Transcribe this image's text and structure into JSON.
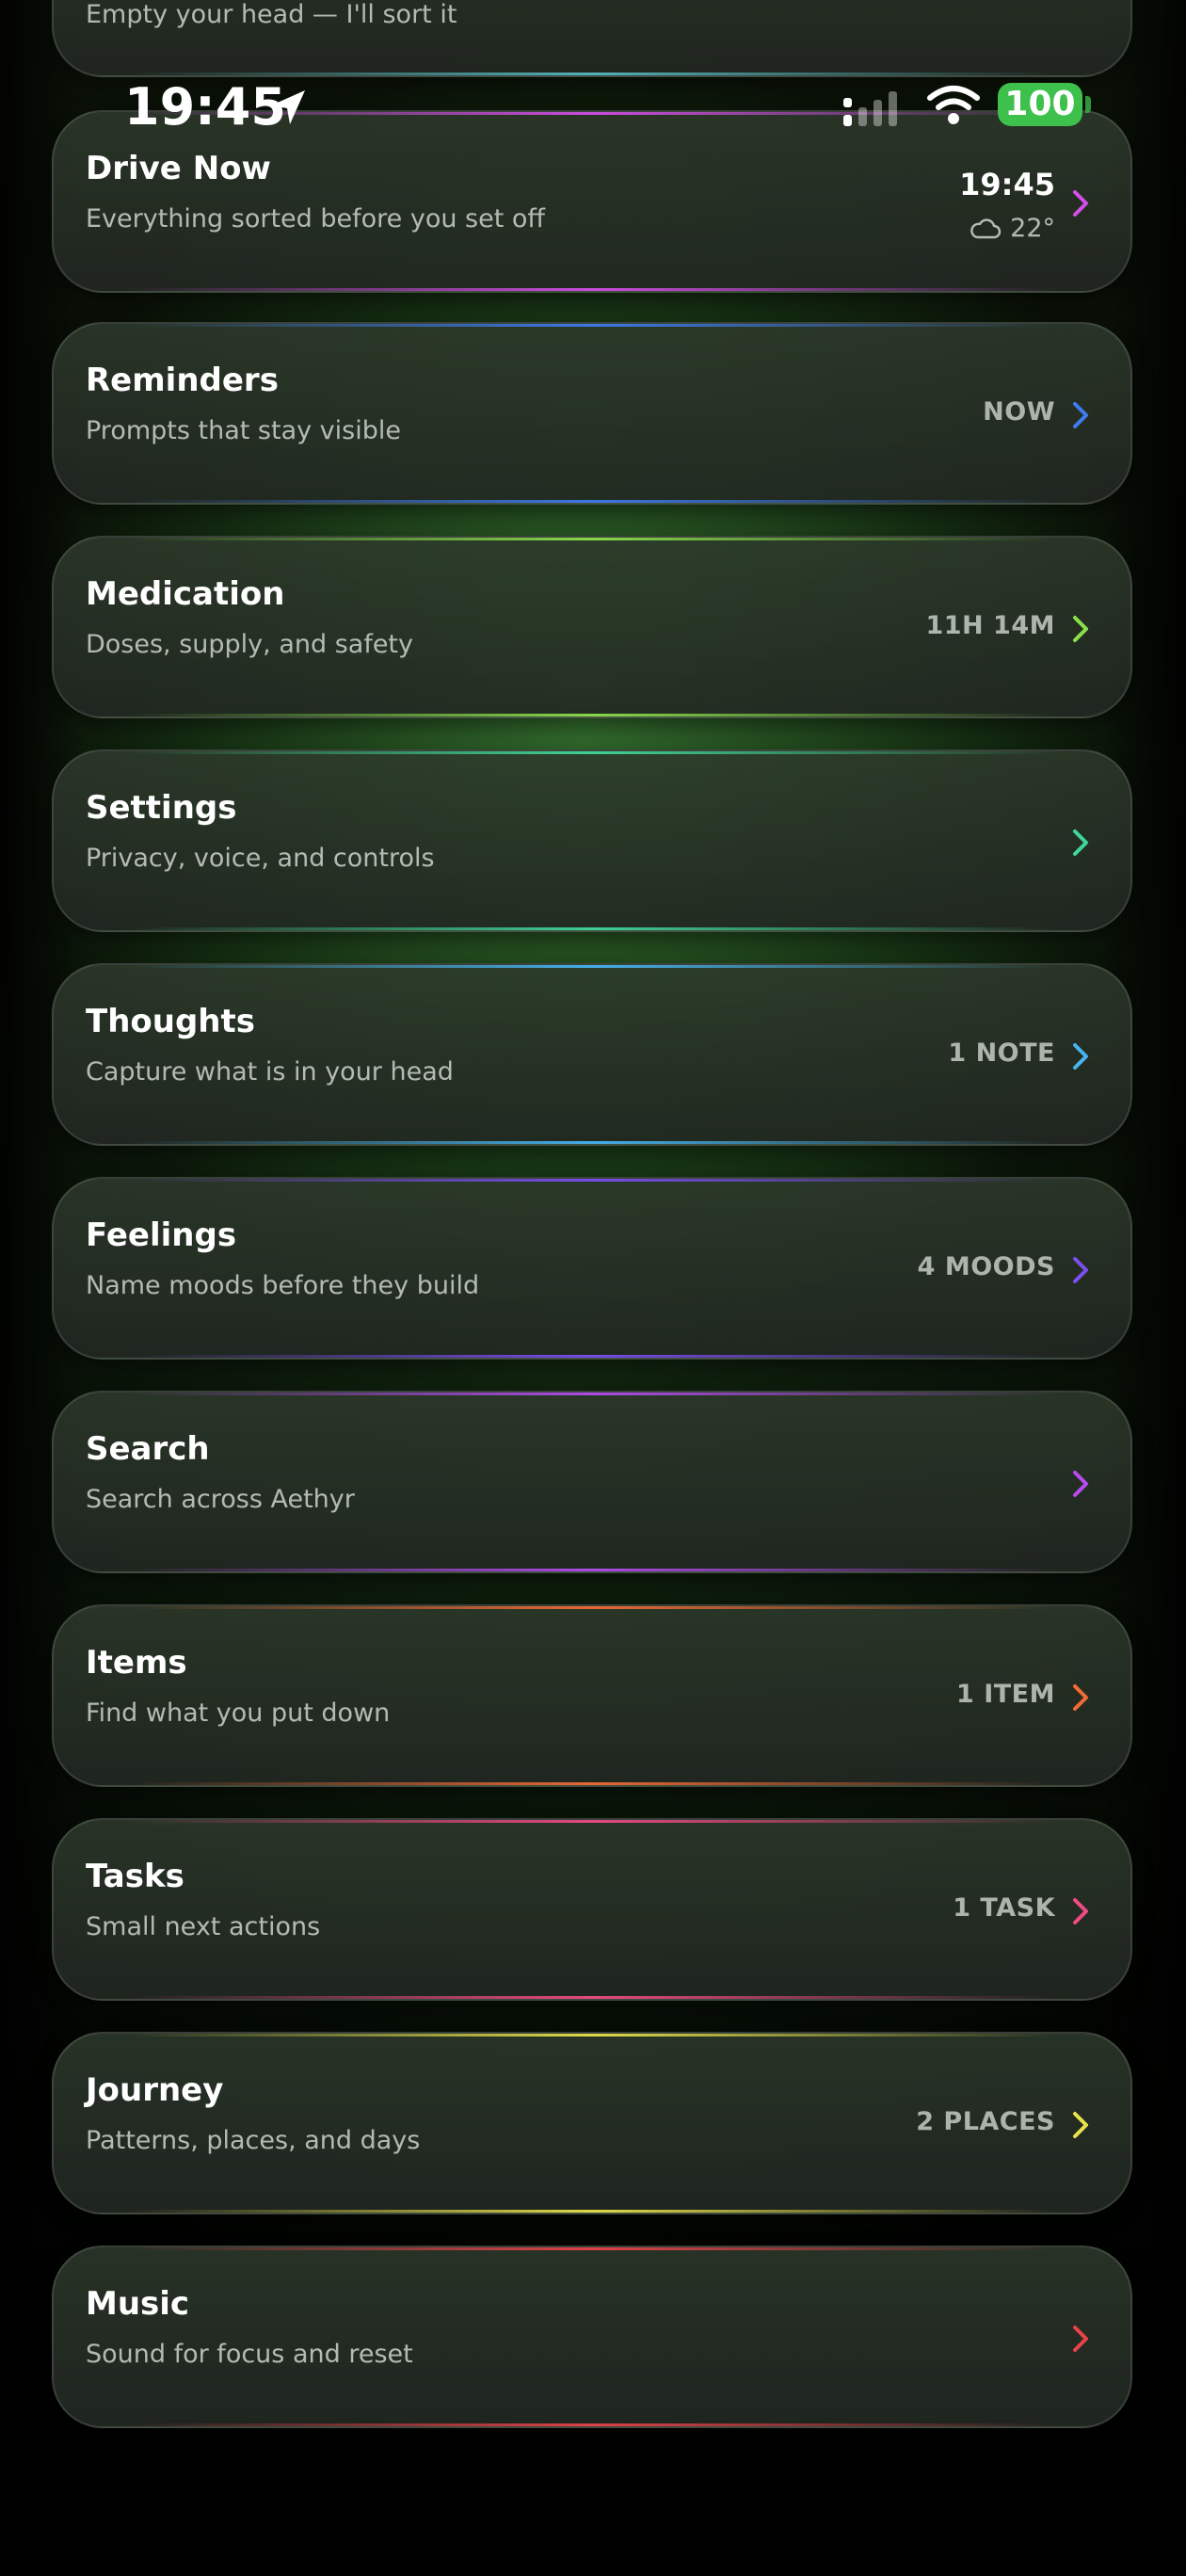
{
  "status_bar": {
    "time": "19:45",
    "battery": "100"
  },
  "top_partial": {
    "subtitle": "Empty your head — I'll sort it"
  },
  "drive": {
    "title": "Drive Now",
    "subtitle": "Everything sorted before you set off",
    "time": "19:45",
    "temp": "22°",
    "accent": "#d24fe6"
  },
  "cards": [
    {
      "title": "Reminders",
      "subtitle": "Prompts that stay visible",
      "badge": "NOW",
      "accent": "#3e7bf0"
    },
    {
      "title": "Medication",
      "subtitle": "Doses, supply, and safety",
      "badge": "11H 14M",
      "accent": "#8be04a"
    },
    {
      "title": "Settings",
      "subtitle": "Privacy, voice, and controls",
      "badge": "",
      "accent": "#3fd89a"
    },
    {
      "title": "Thoughts",
      "subtitle": "Capture what is in your head",
      "badge": "1 NOTE",
      "accent": "#47b3f0"
    },
    {
      "title": "Feelings",
      "subtitle": "Name moods before they build",
      "badge": "4 MOODS",
      "accent": "#7a4ef0"
    },
    {
      "title": "Search",
      "subtitle": "Search across Aethyr",
      "badge": "",
      "accent": "#b44cf0"
    },
    {
      "title": "Items",
      "subtitle": "Find what you put down",
      "badge": "1 ITEM",
      "accent": "#f06b34"
    },
    {
      "title": "Tasks",
      "subtitle": "Small next actions",
      "badge": "1 TASK",
      "accent": "#f04a86"
    },
    {
      "title": "Journey",
      "subtitle": "Patterns, places, and days",
      "badge": "2 PLACES",
      "accent": "#e8e24a"
    },
    {
      "title": "Music",
      "subtitle": "Sound for focus and reset",
      "badge": "",
      "accent": "#e8424a"
    }
  ]
}
